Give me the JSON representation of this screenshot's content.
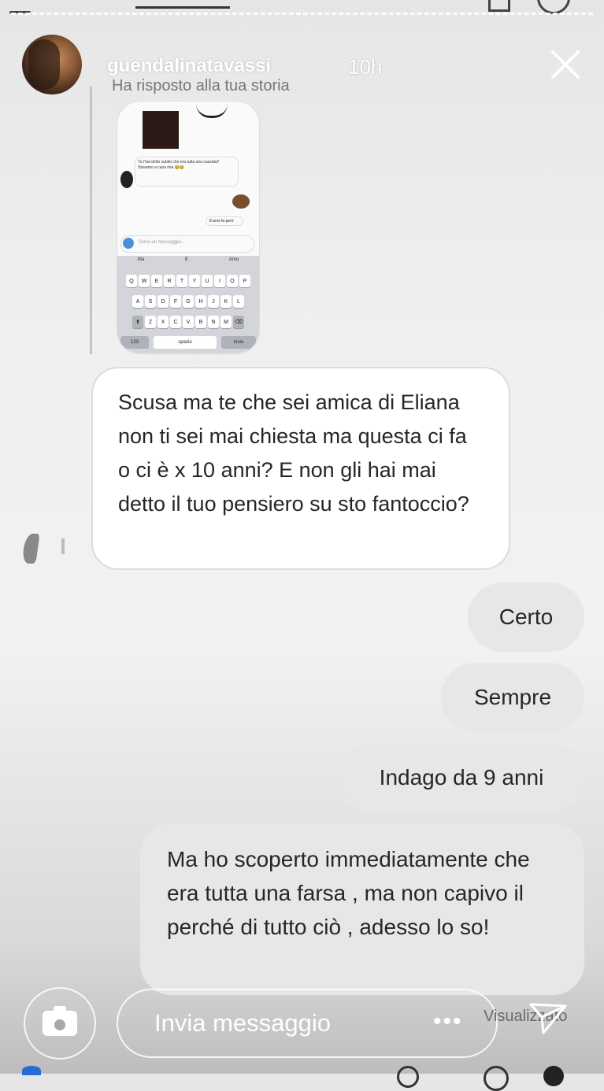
{
  "header": {
    "username": "guendalinatavassi",
    "timestamp": "10h",
    "reply_context": "Ha risposto alla tua storia"
  },
  "story_preview": {
    "message": "Tu l'hai detto subito che era tutta una cazzata!! Stavamo a casa mia 😂😂",
    "small_reply": "8 anni fa però",
    "input_placeholder": "Scrivi un messaggio...",
    "suggestions": [
      "Ma",
      "E",
      "Amo"
    ],
    "keyboard_row1": [
      "Q",
      "W",
      "E",
      "R",
      "T",
      "Y",
      "U",
      "I",
      "O",
      "P"
    ],
    "keyboard_row2": [
      "A",
      "S",
      "D",
      "F",
      "G",
      "H",
      "J",
      "K",
      "L"
    ],
    "keyboard_row3": [
      "Z",
      "X",
      "C",
      "V",
      "B",
      "N",
      "M"
    ],
    "key_123": "123",
    "key_space": "spazio",
    "key_send": "invio"
  },
  "conversation": {
    "received": "Scusa ma te che sei amica di Eliana non ti sei mai chiesta ma questa ci fa o ci è x 10 anni? E non gli hai mai detto il tuo pensiero su sto fantoccio?",
    "sent": [
      "Certo",
      "Sempre",
      "Indago da 9 anni",
      "Ma ho scoperto immediatamente che era tutta una farsa , ma non capivo il perché di tutto ciò , adesso lo so!"
    ]
  },
  "footer": {
    "input_placeholder": "Invia messaggio",
    "seen_label": "Visualizzato"
  },
  "icons": {
    "close": "close-icon",
    "camera": "camera-icon",
    "more": "more-icon",
    "send": "send-icon"
  }
}
